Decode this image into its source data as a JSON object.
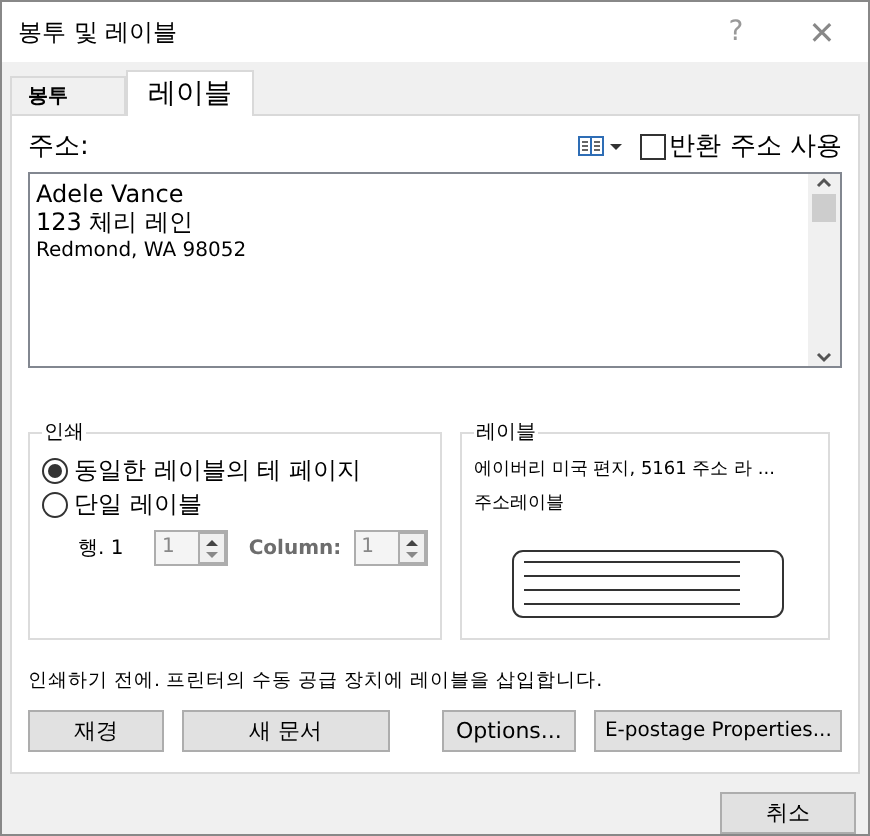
{
  "window": {
    "title": "봉투 및 레이블",
    "help": "?",
    "close": "✕"
  },
  "tabs": [
    {
      "label": "봉투",
      "selected": false
    },
    {
      "label": "레이블",
      "selected": true
    }
  ],
  "address": {
    "label": "주소:",
    "lines": [
      "Adele Vance",
      "123 체리 레인",
      "Redmond, WA 98052"
    ]
  },
  "return_address": {
    "label": "반환 주소 사용",
    "checked": false
  },
  "print_group": {
    "title": "인쇄",
    "options": [
      {
        "label": "동일한 레이블의 테 페이지",
        "selected": true
      },
      {
        "label": "단일 레이블",
        "selected": false
      }
    ],
    "row": {
      "label": "행. 1",
      "value": "1",
      "disabled": true
    },
    "column": {
      "label": "Column:",
      "value": "1",
      "disabled": true
    }
  },
  "label_group": {
    "title": "레이블",
    "lines": [
      "에이버리 미국 편지, 5161 주소 라 ...",
      "주소레이블"
    ]
  },
  "instruction": "인쇄하기 전에. 프린터의 수동 공급 장치에 레이블을 삽입합니다.",
  "buttons": [
    {
      "label": "재경"
    },
    {
      "label": "새 문서"
    },
    {
      "label": "Options..."
    },
    {
      "label": "E-postage Properties..."
    }
  ],
  "cancel": "취소"
}
